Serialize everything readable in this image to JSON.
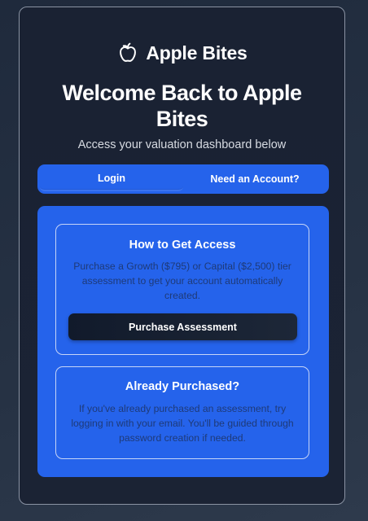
{
  "brand": {
    "name": "Apple Bites",
    "icon": "apple-icon"
  },
  "header": {
    "title": "Welcome Back to Apple Bites",
    "subtitle": "Access your valuation dashboard below"
  },
  "tabs": [
    {
      "label": "Login",
      "active": true
    },
    {
      "label": "Need an Account?",
      "active": false
    }
  ],
  "access_box": {
    "title": "How to Get Access",
    "text": "Purchase a Growth ($795) or Capital ($2,500) tier assessment to get your account automatically created.",
    "button_label": "Purchase Assessment"
  },
  "purchased_box": {
    "title": "Already Purchased?",
    "text": "If you've already purchased an assessment, try logging in with your email. You'll be guided through password creation if needed."
  },
  "colors": {
    "accent": "#2563eb",
    "background": "#1a2233",
    "button": "#111a2b"
  }
}
